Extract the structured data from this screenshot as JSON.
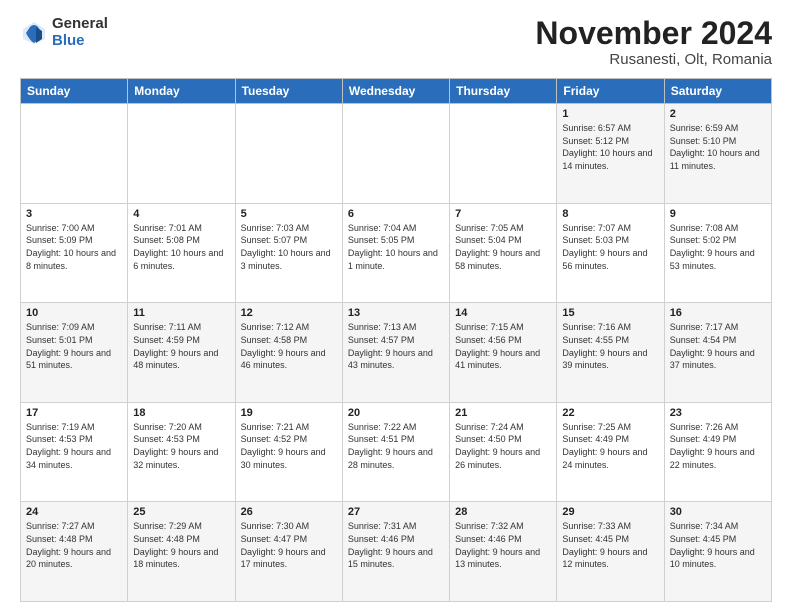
{
  "logo": {
    "general": "General",
    "blue": "Blue"
  },
  "header": {
    "month_title": "November 2024",
    "location": "Rusanesti, Olt, Romania"
  },
  "weekdays": [
    "Sunday",
    "Monday",
    "Tuesday",
    "Wednesday",
    "Thursday",
    "Friday",
    "Saturday"
  ],
  "rows": [
    [
      {
        "day": "",
        "info": ""
      },
      {
        "day": "",
        "info": ""
      },
      {
        "day": "",
        "info": ""
      },
      {
        "day": "",
        "info": ""
      },
      {
        "day": "",
        "info": ""
      },
      {
        "day": "1",
        "info": "Sunrise: 6:57 AM\nSunset: 5:12 PM\nDaylight: 10 hours and 14 minutes."
      },
      {
        "day": "2",
        "info": "Sunrise: 6:59 AM\nSunset: 5:10 PM\nDaylight: 10 hours and 11 minutes."
      }
    ],
    [
      {
        "day": "3",
        "info": "Sunrise: 7:00 AM\nSunset: 5:09 PM\nDaylight: 10 hours and 8 minutes."
      },
      {
        "day": "4",
        "info": "Sunrise: 7:01 AM\nSunset: 5:08 PM\nDaylight: 10 hours and 6 minutes."
      },
      {
        "day": "5",
        "info": "Sunrise: 7:03 AM\nSunset: 5:07 PM\nDaylight: 10 hours and 3 minutes."
      },
      {
        "day": "6",
        "info": "Sunrise: 7:04 AM\nSunset: 5:05 PM\nDaylight: 10 hours and 1 minute."
      },
      {
        "day": "7",
        "info": "Sunrise: 7:05 AM\nSunset: 5:04 PM\nDaylight: 9 hours and 58 minutes."
      },
      {
        "day": "8",
        "info": "Sunrise: 7:07 AM\nSunset: 5:03 PM\nDaylight: 9 hours and 56 minutes."
      },
      {
        "day": "9",
        "info": "Sunrise: 7:08 AM\nSunset: 5:02 PM\nDaylight: 9 hours and 53 minutes."
      }
    ],
    [
      {
        "day": "10",
        "info": "Sunrise: 7:09 AM\nSunset: 5:01 PM\nDaylight: 9 hours and 51 minutes."
      },
      {
        "day": "11",
        "info": "Sunrise: 7:11 AM\nSunset: 4:59 PM\nDaylight: 9 hours and 48 minutes."
      },
      {
        "day": "12",
        "info": "Sunrise: 7:12 AM\nSunset: 4:58 PM\nDaylight: 9 hours and 46 minutes."
      },
      {
        "day": "13",
        "info": "Sunrise: 7:13 AM\nSunset: 4:57 PM\nDaylight: 9 hours and 43 minutes."
      },
      {
        "day": "14",
        "info": "Sunrise: 7:15 AM\nSunset: 4:56 PM\nDaylight: 9 hours and 41 minutes."
      },
      {
        "day": "15",
        "info": "Sunrise: 7:16 AM\nSunset: 4:55 PM\nDaylight: 9 hours and 39 minutes."
      },
      {
        "day": "16",
        "info": "Sunrise: 7:17 AM\nSunset: 4:54 PM\nDaylight: 9 hours and 37 minutes."
      }
    ],
    [
      {
        "day": "17",
        "info": "Sunrise: 7:19 AM\nSunset: 4:53 PM\nDaylight: 9 hours and 34 minutes."
      },
      {
        "day": "18",
        "info": "Sunrise: 7:20 AM\nSunset: 4:53 PM\nDaylight: 9 hours and 32 minutes."
      },
      {
        "day": "19",
        "info": "Sunrise: 7:21 AM\nSunset: 4:52 PM\nDaylight: 9 hours and 30 minutes."
      },
      {
        "day": "20",
        "info": "Sunrise: 7:22 AM\nSunset: 4:51 PM\nDaylight: 9 hours and 28 minutes."
      },
      {
        "day": "21",
        "info": "Sunrise: 7:24 AM\nSunset: 4:50 PM\nDaylight: 9 hours and 26 minutes."
      },
      {
        "day": "22",
        "info": "Sunrise: 7:25 AM\nSunset: 4:49 PM\nDaylight: 9 hours and 24 minutes."
      },
      {
        "day": "23",
        "info": "Sunrise: 7:26 AM\nSunset: 4:49 PM\nDaylight: 9 hours and 22 minutes."
      }
    ],
    [
      {
        "day": "24",
        "info": "Sunrise: 7:27 AM\nSunset: 4:48 PM\nDaylight: 9 hours and 20 minutes."
      },
      {
        "day": "25",
        "info": "Sunrise: 7:29 AM\nSunset: 4:48 PM\nDaylight: 9 hours and 18 minutes."
      },
      {
        "day": "26",
        "info": "Sunrise: 7:30 AM\nSunset: 4:47 PM\nDaylight: 9 hours and 17 minutes."
      },
      {
        "day": "27",
        "info": "Sunrise: 7:31 AM\nSunset: 4:46 PM\nDaylight: 9 hours and 15 minutes."
      },
      {
        "day": "28",
        "info": "Sunrise: 7:32 AM\nSunset: 4:46 PM\nDaylight: 9 hours and 13 minutes."
      },
      {
        "day": "29",
        "info": "Sunrise: 7:33 AM\nSunset: 4:45 PM\nDaylight: 9 hours and 12 minutes."
      },
      {
        "day": "30",
        "info": "Sunrise: 7:34 AM\nSunset: 4:45 PM\nDaylight: 9 hours and 10 minutes."
      }
    ]
  ]
}
